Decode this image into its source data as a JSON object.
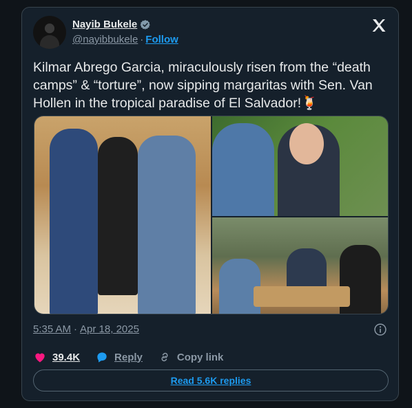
{
  "author": {
    "display_name": "Nayib Bukele",
    "handle": "@nayibbukele",
    "separator": "·",
    "follow_label": "Follow"
  },
  "tweet": {
    "text": "Kilmar Abrego Garcia, miraculously risen from the “death camps” & “torture”, now sipping margaritas with Sen. Van Hollen in the tropical paradise of El Salvador!🍹"
  },
  "meta": {
    "time": "5:35 AM",
    "separator": "·",
    "date": "Apr 18, 2025"
  },
  "actions": {
    "like_count": "39.4K",
    "reply_label": "Reply",
    "copy_label": "Copy link"
  },
  "replies_button": "Read 5.6K replies",
  "icons": [
    "verified-badge-icon",
    "x-logo-icon",
    "info-icon",
    "heart-icon",
    "reply-bubble-icon",
    "link-icon"
  ],
  "colors": {
    "accent": "#1d9bf0",
    "like": "#f91880",
    "background": "#15202b"
  }
}
